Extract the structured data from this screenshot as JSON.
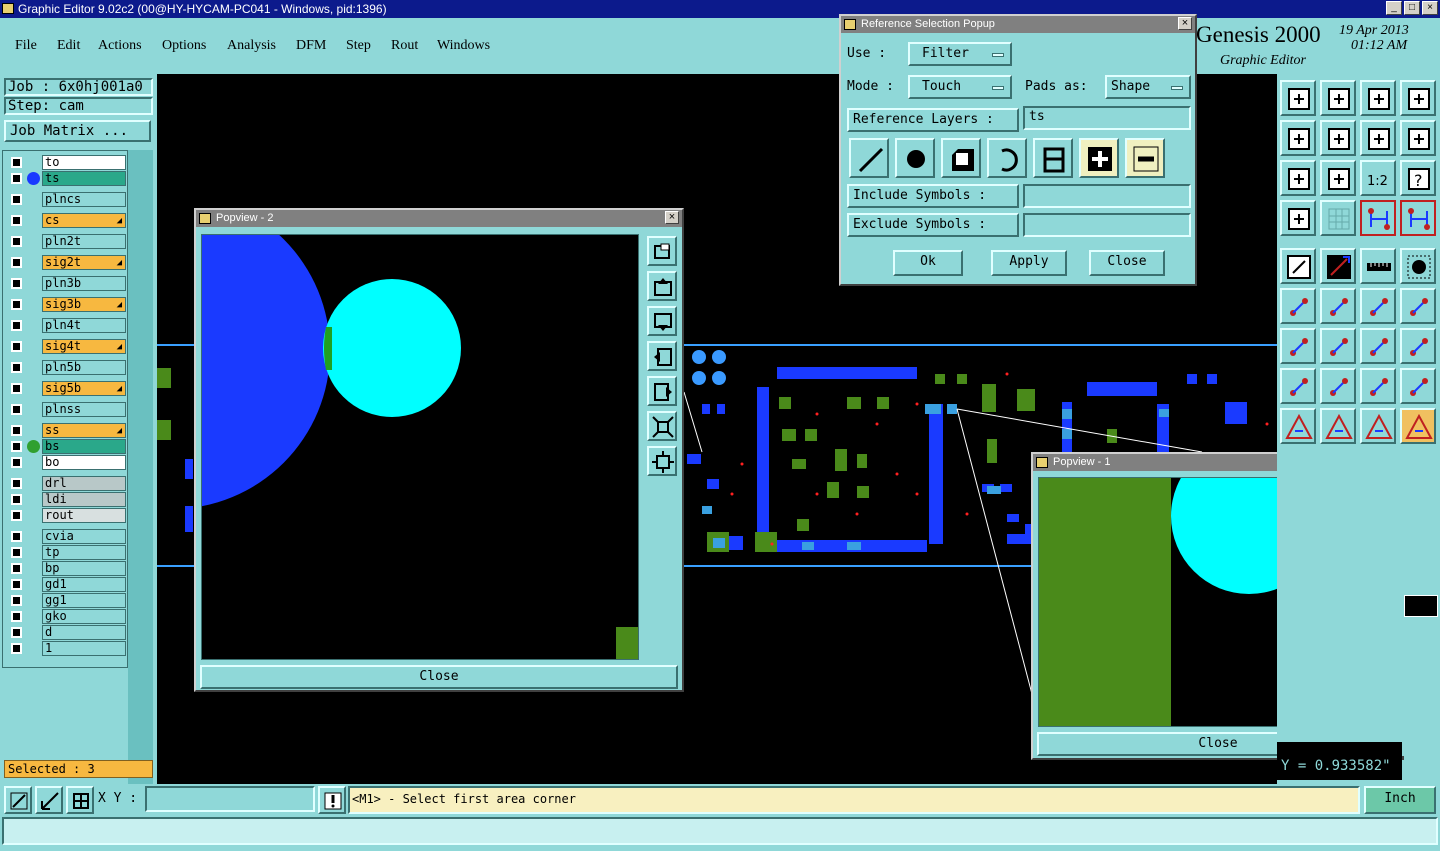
{
  "window": {
    "title": "Graphic Editor 9.02c2 (00@HY-HYCAM-PC041 - Windows, pid:1396)"
  },
  "menu": [
    "File",
    "Edit",
    "Actions",
    "Options",
    "Analysis",
    "DFM",
    "Step",
    "Rout",
    "Windows"
  ],
  "brand": {
    "name": "Genesis 2000",
    "subtitle": "Graphic Editor",
    "date": "19 Apr 2013",
    "time": "01:12 AM"
  },
  "job": {
    "job_label": "Job : 6x0hj001a0",
    "step_label": "Step: cam",
    "matrix_button": "Job Matrix ..."
  },
  "layers": [
    {
      "name": "to",
      "color": "#ffffff"
    },
    {
      "name": "ts",
      "color": "#2aa88a"
    },
    {
      "name": "plncs",
      "color": "#8fd8d8"
    },
    {
      "name": "cs",
      "color": "#f7b840"
    },
    {
      "name": "pln2t",
      "color": "#8fd8d8"
    },
    {
      "name": "sig2t",
      "color": "#f7b840"
    },
    {
      "name": "pln3b",
      "color": "#8fd8d8"
    },
    {
      "name": "sig3b",
      "color": "#f7b840"
    },
    {
      "name": "pln4t",
      "color": "#8fd8d8"
    },
    {
      "name": "sig4t",
      "color": "#f7b840"
    },
    {
      "name": "pln5b",
      "color": "#8fd8d8"
    },
    {
      "name": "sig5b",
      "color": "#f7b840"
    },
    {
      "name": "plnss",
      "color": "#8fd8d8"
    },
    {
      "name": "ss",
      "color": "#f7b840"
    },
    {
      "name": "bs",
      "color": "#2aa88a"
    },
    {
      "name": "bo",
      "color": "#ffffff"
    },
    {
      "name": "drl",
      "color": "#b8c8c8"
    },
    {
      "name": "ldi",
      "color": "#b8c8c8"
    },
    {
      "name": "rout",
      "color": "#d8e0e0"
    },
    {
      "name": "cvia",
      "color": "#8fd8d8"
    },
    {
      "name": "tp",
      "color": "#8fd8d8"
    },
    {
      "name": "bp",
      "color": "#8fd8d8"
    },
    {
      "name": "gd1",
      "color": "#8fd8d8"
    },
    {
      "name": "gg1",
      "color": "#8fd8d8"
    },
    {
      "name": "gko",
      "color": "#8fd8d8"
    },
    {
      "name": "d",
      "color": "#8fd8d8"
    },
    {
      "name": "1",
      "color": "#8fd8d8"
    }
  ],
  "selected": "Selected : 3",
  "status": {
    "xy_label": "X Y :",
    "xy_value": "",
    "prompt": "<M1> - Select first area corner",
    "units": "Inch",
    "coord": "Y = 0.933582\""
  },
  "popview2": {
    "title": "Popview - 2",
    "close": "Close"
  },
  "popview1": {
    "title": "Popview - 1",
    "close": "Close"
  },
  "refsel": {
    "title": "Reference Selection Popup",
    "use_label": "Use    :",
    "use_value": "Filter",
    "mode_label": "Mode   :",
    "mode_value": "Touch",
    "pads_label": "Pads as:",
    "pads_value": "Shape",
    "ref_layers_label": "Reference Layers :",
    "ref_layers_value": "ts",
    "include_label": "Include Symbols  :",
    "include_value": "",
    "exclude_label": "Exclude Symbols  :",
    "exclude_value": "",
    "ok": "Ok",
    "apply": "Apply",
    "close": "Close"
  }
}
